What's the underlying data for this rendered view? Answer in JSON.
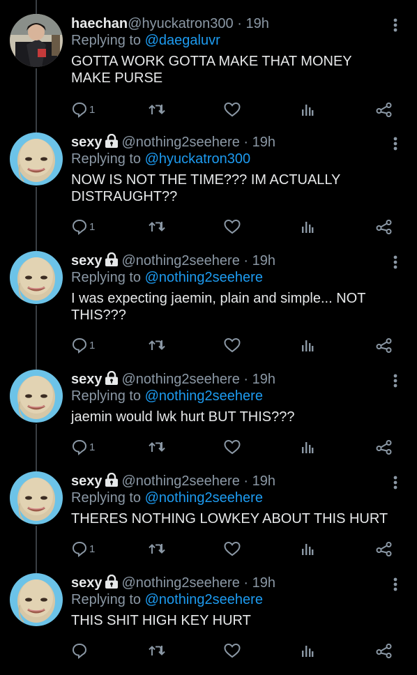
{
  "tweets": [
    {
      "name": "haechan",
      "verified_lock": false,
      "handle": "@hyuckatron300",
      "time": "· 19h",
      "reply_prefix": "Replying to",
      "reply_to": "@daegaluvr",
      "text": "GOTTA WORK GOTTA MAKE THAT MONEY MAKE PURSE",
      "reply_count": "1"
    },
    {
      "name": "sexy",
      "verified_lock": true,
      "handle": "@nothing2seehere",
      "time": "· 19h",
      "reply_prefix": "Replying to",
      "reply_to": "@hyuckatron300",
      "text": "NOW IS NOT THE TIME??? IM ACTUALLY DISTRAUGHT??",
      "reply_count": "1"
    },
    {
      "name": "sexy",
      "verified_lock": true,
      "handle": "@nothing2seehere",
      "time": "· 19h",
      "reply_prefix": "Replying to",
      "reply_to": "@nothing2seehere",
      "text": "I was expecting jaemin, plain and simple... NOT THIS???",
      "reply_count": "1"
    },
    {
      "name": "sexy",
      "verified_lock": true,
      "handle": "@nothing2seehere",
      "time": "· 19h",
      "reply_prefix": "Replying to",
      "reply_to": "@nothing2seehere",
      "text": "jaemin would lwk hurt BUT THIS???",
      "reply_count": "1"
    },
    {
      "name": "sexy",
      "verified_lock": true,
      "handle": "@nothing2seehere",
      "time": "· 19h",
      "reply_prefix": "Replying to",
      "reply_to": "@nothing2seehere",
      "text": "THERES NOTHING LOWKEY ABOUT THIS HURT",
      "reply_count": "1"
    },
    {
      "name": "sexy",
      "verified_lock": true,
      "handle": "@nothing2seehere",
      "time": "· 19h",
      "reply_prefix": "Replying to",
      "reply_to": "@nothing2seehere",
      "text": "THIS SHIT HIGH KEY HURT",
      "reply_count": ""
    }
  ],
  "colors": {
    "background": "#000000",
    "text": "#e7e9ea",
    "muted": "#8b98a5",
    "link": "#1d9bf0",
    "thread_line": "#3a3f44"
  }
}
